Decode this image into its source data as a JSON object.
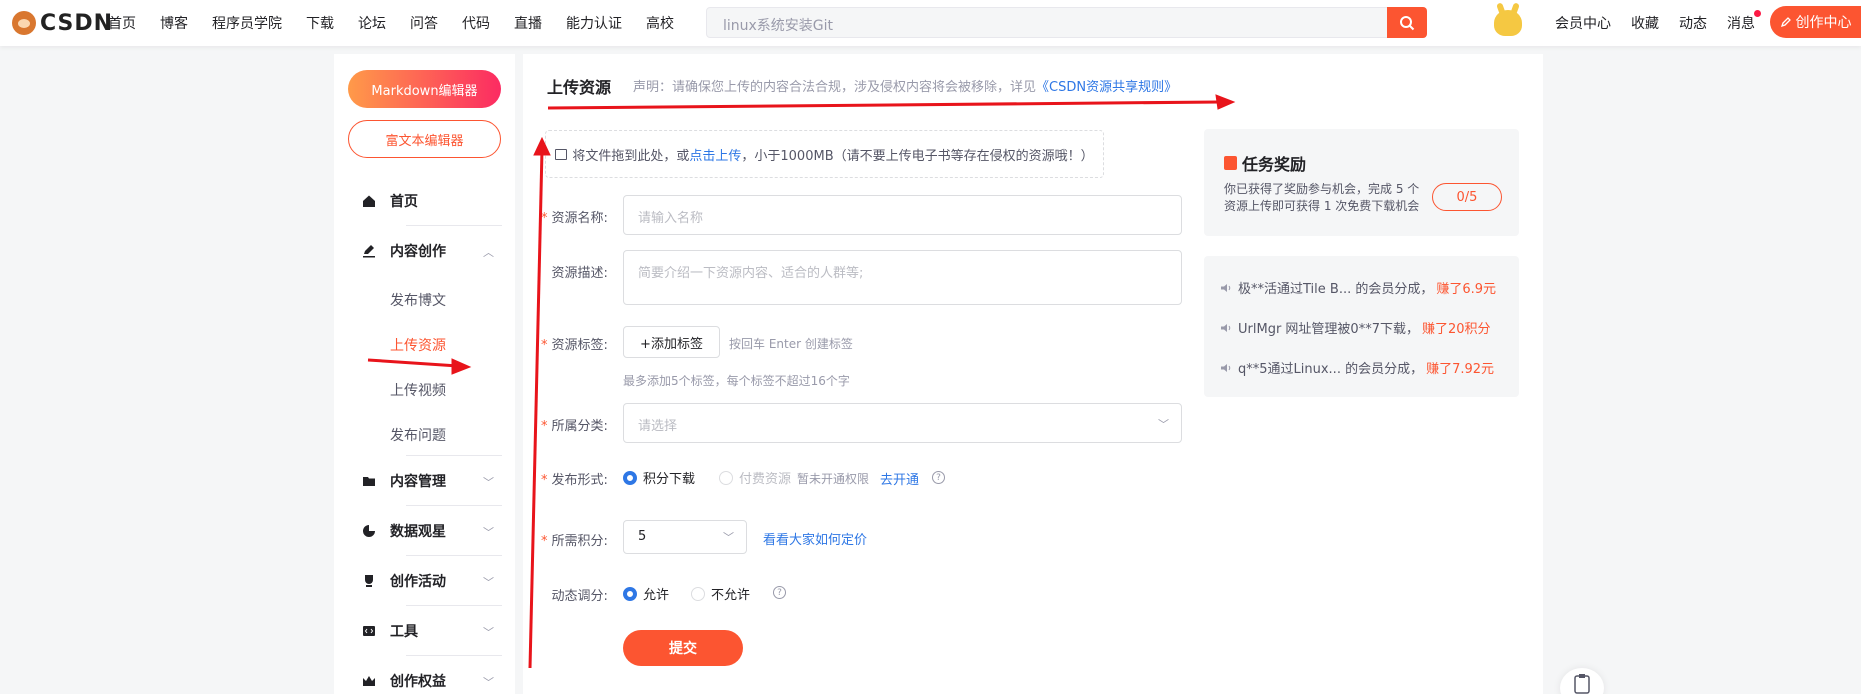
{
  "topbar": {
    "brand": "CSDN",
    "nav": [
      "首页",
      "博客",
      "程序员学院",
      "下载",
      "论坛",
      "问答",
      "代码",
      "直播",
      "能力认证",
      "高校"
    ],
    "search_placeholder": "linux系统安装Git",
    "tools": [
      "会员中心",
      "收藏",
      "动态",
      "消息"
    ],
    "create_label": "创作中心"
  },
  "sidebar": {
    "markdown_label": "Markdown编辑器",
    "richtext_label": "富文本编辑器",
    "home": "首页",
    "content_create": "内容创作",
    "sub_items": [
      "发布博文",
      "上传资源",
      "上传视频",
      "发布问题"
    ],
    "content_manage": "内容管理",
    "data_overview": "数据观星",
    "create_activity": "创作活动",
    "tools": "工具",
    "rights": "创作权益"
  },
  "main": {
    "title": "上传资源",
    "notice_prefix": "声明：请确保您上传的内容合法合规，涉及侵权内容将会被移除，详见",
    "notice_link": "《CSDN资源共享规则》",
    "drop_prefix": "将文件拖到此处，或",
    "drop_link": "点击上传",
    "drop_suffix": "，小于1000MB（请不要上传电子书等存在侵权的资源哦！）",
    "name_label": "资源名称:",
    "name_placeholder": "请输入名称",
    "desc_label": "资源描述:",
    "desc_placeholder": "简要介绍一下资源内容、适合的人群等;",
    "tag_label": "资源标签:",
    "tag_button": "+添加标签",
    "tag_hint": "按回车 Enter 创建标签",
    "tag_limit": "最多添加5个标签，每个标签不超过16个字",
    "category_label": "所属分类:",
    "category_placeholder": "请选择",
    "publish_label": "发布形式:",
    "publish_opt1": "积分下载",
    "publish_opt2": "付费资源",
    "publish_note": "暂未开通权限",
    "publish_link": "去开通",
    "points_label": "所需积分:",
    "points_value": "5",
    "points_link": "看看大家如何定价",
    "dynamic_label": "动态调分:",
    "dynamic_opt1": "允许",
    "dynamic_opt2": "不允许",
    "submit": "提交"
  },
  "task": {
    "title": "任务奖励",
    "desc": "你已获得了奖励参与机会，完成 5 个资源上传即可获得 1 次免费下载机会",
    "count": "0/5"
  },
  "feed": [
    {
      "text": "极**活通过Tile B... 的会员分成，",
      "earn": "赚了6.9元"
    },
    {
      "text": "UrlMgr 网址管理被0**7下载，",
      "earn": "赚了20积分"
    },
    {
      "text": "q**5通过Linux... 的会员分成，",
      "earn": "赚了7.92元"
    }
  ],
  "colors": {
    "accent": "#fc5531",
    "link": "#2e77e5",
    "annotation": "#e8141b"
  }
}
